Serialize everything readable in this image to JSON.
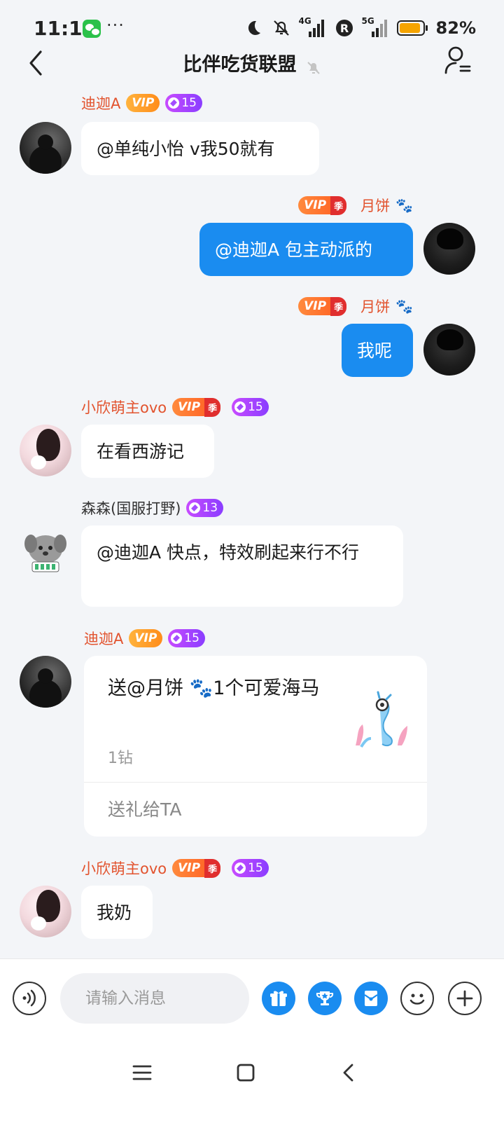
{
  "status_bar": {
    "time": "11:10",
    "more": "···",
    "network_1": "4G",
    "network_2": "5G",
    "battery": "82%"
  },
  "header": {
    "title": "比伴吃货联盟"
  },
  "messages": [
    {
      "type": "text",
      "side": "left",
      "nickname": "迪迦A",
      "vip": "VIP",
      "level": "15",
      "text": "@单纯小怡 v我50就有"
    },
    {
      "type": "text",
      "side": "right",
      "nickname": "月饼",
      "vip": "VIP",
      "season": "季",
      "text": "@迪迦A 包主动派的"
    },
    {
      "type": "text",
      "side": "right",
      "nickname": "月饼",
      "vip": "VIP",
      "season": "季",
      "text": "我呢"
    },
    {
      "type": "text",
      "side": "left",
      "nickname": "小欣萌主ovo",
      "vip": "VIP",
      "season": "季",
      "level": "15",
      "text": "在看西游记"
    },
    {
      "type": "text",
      "side": "left",
      "nickname": "森森(国服打野)",
      "level": "13",
      "text": "@迪迦A 快点，特效刷起来行不行"
    },
    {
      "type": "gift",
      "side": "left",
      "nickname": "迪迦A",
      "vip": "VIP",
      "level": "15",
      "gift_text": "送@月饼 🐾1个可爱海马",
      "cost": "1钻",
      "action": "送礼给TA"
    },
    {
      "type": "text",
      "side": "left",
      "nickname": "小欣萌主ovo",
      "vip": "VIP",
      "season": "季",
      "level": "15",
      "text": "我奶"
    }
  ],
  "input": {
    "placeholder": "请输入消息"
  },
  "colors": {
    "accent_blue": "#1a8cf0",
    "nickname_orange": "#e2532e",
    "level_purple": "#a34cff",
    "background": "#f3f5f8"
  },
  "icons": {
    "back": "chevron-left-icon",
    "mute": "bell-off-icon",
    "members": "user-list-icon",
    "voice": "voice-icon",
    "gift": "gift-icon",
    "trophy": "trophy-icon",
    "envelope": "red-packet-icon",
    "emoji": "emoji-icon",
    "plus": "plus-icon"
  }
}
